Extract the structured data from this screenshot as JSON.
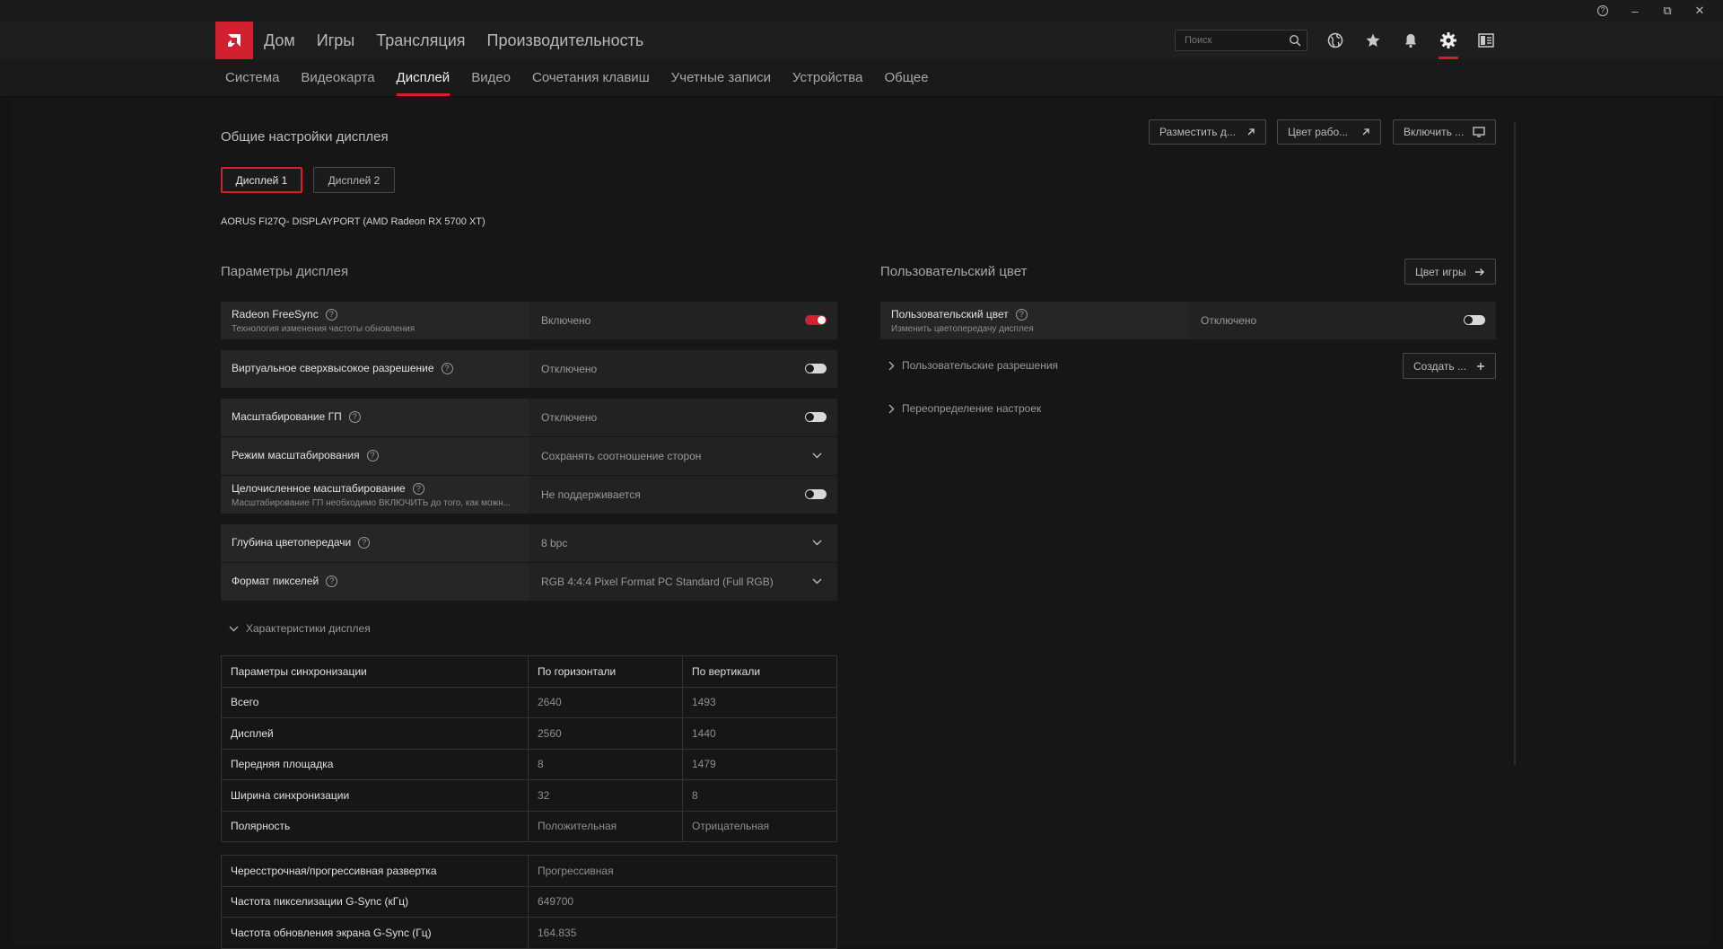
{
  "window": {
    "help": "?",
    "minimize": "–",
    "restore": "⧉",
    "close": "✕"
  },
  "nav": {
    "main": [
      "Дом",
      "Игры",
      "Трансляция",
      "Производительность"
    ],
    "search_placeholder": "Поиск",
    "sub": [
      "Система",
      "Видеокарта",
      "Дисплей",
      "Видео",
      "Сочетания клавиш",
      "Учетные записи",
      "Устройства",
      "Общее"
    ],
    "active_sub": "Дисплей"
  },
  "general": {
    "title": "Общие настройки дисплея",
    "actions": [
      "Разместить д...",
      "Цвет рабо...",
      "Включить ..."
    ],
    "displays": [
      "Дисплей 1",
      "Дисплей 2"
    ],
    "selected_display": "Дисплей 1",
    "monitor": "AORUS FI27Q- DISPLAYPORT (AMD Radeon RX 5700 XT)"
  },
  "params": {
    "title": "Параметры дисплея",
    "rows": [
      {
        "label": "Radeon FreeSync",
        "sub": "Технология изменения частоты обновления",
        "value": "Включено",
        "control": "toggle-on"
      },
      {
        "label": "Виртуальное сверхвысокое разрешение",
        "value": "Отключено",
        "control": "toggle-off"
      },
      {
        "label": "Масштабирование ГП",
        "value": "Отключено",
        "control": "toggle-off"
      },
      {
        "label": "Режим масштабирования",
        "value": "Сохранять соотношение сторон",
        "control": "dropdown"
      },
      {
        "label": "Целочисленное масштабирование",
        "sub": "Масштабирование ГП необходимо ВКЛЮЧИТЬ до того, как можн...",
        "value": "Не поддерживается",
        "control": "toggle-off"
      },
      {
        "label": "Глубина цветопередачи",
        "value": "8 bpc",
        "control": "dropdown"
      },
      {
        "label": "Формат пикселей",
        "value": "RGB 4:4:4 Pixel Format PC Standard (Full RGB)",
        "control": "dropdown"
      }
    ]
  },
  "characteristics": {
    "title": "Характеристики дисплея",
    "header": [
      "Параметры синхронизации",
      "По горизонтали",
      "По вертикали"
    ],
    "rows": [
      [
        "Всего",
        "2640",
        "1493"
      ],
      [
        "Дисплей",
        "2560",
        "1440"
      ],
      [
        "Передняя площадка",
        "8",
        "1479"
      ],
      [
        "Ширина синхронизации",
        "32",
        "8"
      ],
      [
        "Полярность",
        "Положительная",
        "Отрицательная"
      ]
    ],
    "rows2": [
      [
        "Чересстрочная/прогрессивная развертка",
        "Прогрессивная"
      ],
      [
        "Частота пикселизации G-Sync (кГц)",
        "649700"
      ],
      [
        "Частота обновления экрана G-Sync (Гц)",
        "164.835"
      ]
    ]
  },
  "custom": {
    "title": "Пользовательский цвет",
    "game_color": "Цвет игры",
    "row": {
      "label": "Пользовательский цвет",
      "sub": "Изменить цветопередачу дисплея",
      "value": "Отключено"
    },
    "resolutions": "Пользовательские разрешения",
    "create": "Создать ...",
    "override": "Переопределение настроек"
  }
}
